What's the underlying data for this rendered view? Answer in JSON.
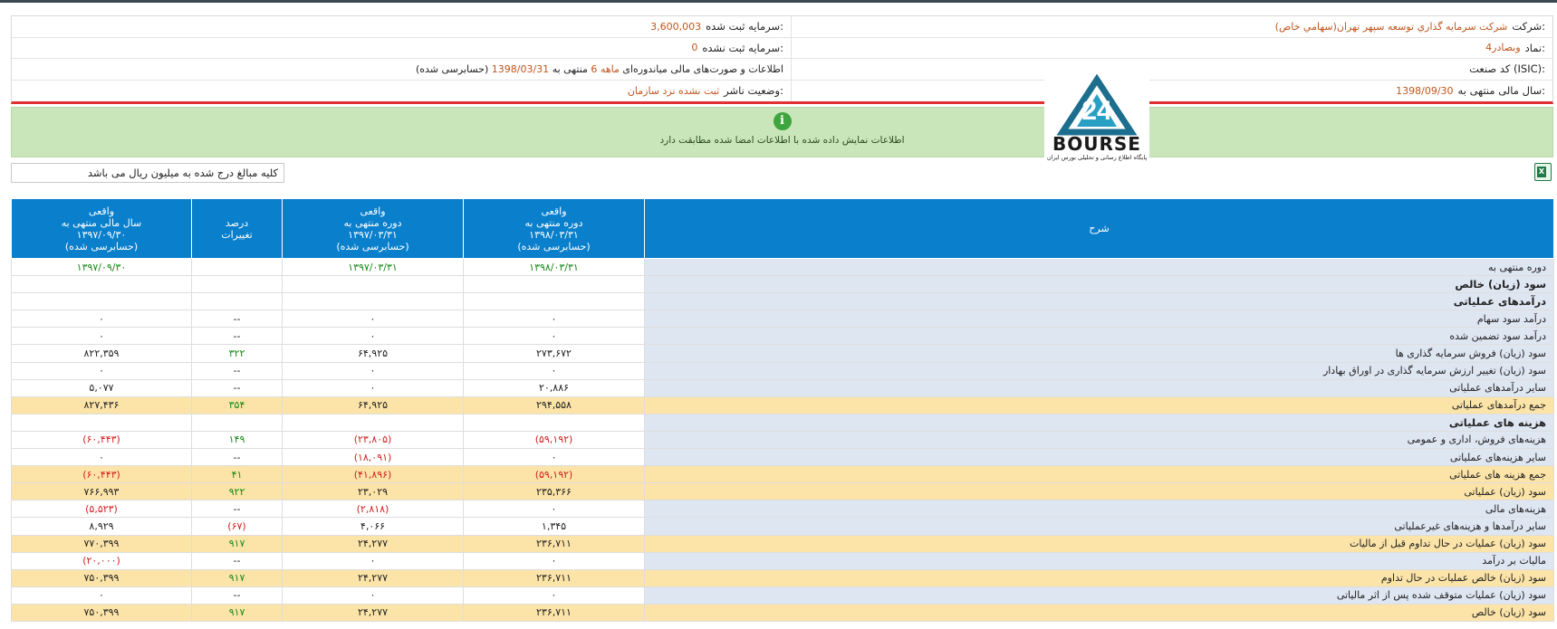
{
  "company_info": {
    "company_label": "شرکت:",
    "company_value": "شرکت سرمايه گذاري توسعه سپهر تهران(سهامي خاص)",
    "registered_capital_label": "سرمایه ثبت شده:",
    "registered_capital_value": "3,600,003",
    "symbol_label": "نماد:",
    "symbol_value": "وبصادر4",
    "unregistered_capital_label": "سرمایه ثبت نشده:",
    "unregistered_capital_value": "0",
    "isic_label": "کد صنعت (ISIC):",
    "isic_value": "",
    "report_text_1": "اطلاعات و صورت‌های مالی میاندوره‌ای",
    "report_period": "6 ماهه",
    "report_text_2": "منتهی به",
    "report_date": "1398/03/31",
    "report_status": "(حسابرسی شده)",
    "fiscal_year_label": "سال مالی منتهی به:",
    "fiscal_year_value": "1398/09/30",
    "publisher_status_label": "وضعیت ناشر:",
    "publisher_status_value": "ثبت نشده نزد سازمان"
  },
  "notice": {
    "icon": "info-icon",
    "message": "اطلاعات نمایش داده شده با اطلاعات امضا شده مطابقت دارد"
  },
  "logo": {
    "word": "BOURSE",
    "mark": "24",
    "subtitle": "پایگاه اطلاع رسانی و تحلیلی بورس ایران"
  },
  "units_note": "کلیه مبالغ درج شده به میلیون ریال می باشد",
  "colors": {
    "header_blue": "#0a7fcb",
    "highlight_row": "#fce4a8",
    "description_bg": "#dee6f2",
    "notice_green": "#c8e6b9",
    "value_orange": "#c0561c",
    "positive_green": "#168a16",
    "negative_red": "#d32020"
  },
  "table": {
    "headers": {
      "description": "شرح",
      "col1": [
        "واقعی",
        "دوره منتهی به",
        "۱۳۹۸/۰۳/۳۱",
        "(حسابرسی شده)"
      ],
      "col2": [
        "واقعی",
        "دوره منتهی به",
        "۱۳۹۷/۰۳/۳۱",
        "(حسابرسی شده)"
      ],
      "col3": [
        "درصد",
        "تغییرات"
      ],
      "col4": [
        "واقعی",
        "سال مالی منتهی به",
        "۱۳۹۷/۰۹/۳۰",
        "(حسابرسی شده)"
      ]
    },
    "rows": [
      {
        "desc": "دوره منتهی به",
        "c1": "۱۳۹۸/۰۳/۳۱",
        "c2": "۱۳۹۷/۰۳/۳۱",
        "c3": "",
        "c4": "۱۳۹۷/۰۹/۳۰",
        "style": "g",
        "row": ""
      },
      {
        "desc": "سود (زیان) خالص",
        "c1": "",
        "c2": "",
        "c3": "",
        "c4": "",
        "style": "k",
        "row": "bold"
      },
      {
        "desc": "درآمدهای عملیاتی",
        "c1": "",
        "c2": "",
        "c3": "",
        "c4": "",
        "style": "k",
        "row": "bold"
      },
      {
        "desc": "درآمد سود سهام",
        "c1": "۰",
        "c2": "۰",
        "c3": "--",
        "c4": "۰",
        "style": "k",
        "row": ""
      },
      {
        "desc": "درآمد سود تضمین شده",
        "c1": "۰",
        "c2": "۰",
        "c3": "--",
        "c4": "۰",
        "style": "k",
        "row": ""
      },
      {
        "desc": "سود (زیان) فروش سرمایه گذاری ها",
        "c1": "۲۷۳,۶۷۲",
        "c2": "۶۴,۹۲۵",
        "c3": "۳۲۲",
        "c4": "۸۲۲,۳۵۹",
        "style": "k",
        "row": ""
      },
      {
        "desc": "سود (زیان) تغییر ارزش سرمایه گذاری در اوراق بهادار",
        "c1": "۰",
        "c2": "۰",
        "c3": "--",
        "c4": "۰",
        "style": "k",
        "row": ""
      },
      {
        "desc": "سایر درآمدهای عملیاتی",
        "c1": "۲۰,۸۸۶",
        "c2": "۰",
        "c3": "--",
        "c4": "۵,۰۷۷",
        "style": "k",
        "row": ""
      },
      {
        "desc": "جمع درآمدهای عملیاتی",
        "c1": "۲۹۴,۵۵۸",
        "c2": "۶۴,۹۲۵",
        "c3": "۳۵۴",
        "c4": "۸۲۷,۴۳۶",
        "style": "k",
        "row": "hl"
      },
      {
        "desc": "هزینه های عملیاتی",
        "c1": "",
        "c2": "",
        "c3": "",
        "c4": "",
        "style": "k",
        "row": "bold"
      },
      {
        "desc": "هزینه‌های فروش، اداری و عمومی",
        "c1": "(۵۹,۱۹۲)",
        "c2": "(۲۳,۸۰۵)",
        "c3": "۱۴۹",
        "c4": "(۶۰,۴۴۳)",
        "style": "neg",
        "row": ""
      },
      {
        "desc": "سایر هزینه‌های عملیاتی",
        "c1": "۰",
        "c2": "(۱۸,۰۹۱)",
        "c3": "--",
        "c4": "۰",
        "style": "neg",
        "row": ""
      },
      {
        "desc": "جمع هزینه های عملیاتی",
        "c1": "(۵۹,۱۹۲)",
        "c2": "(۴۱,۸۹۶)",
        "c3": "۴۱",
        "c4": "(۶۰,۴۴۳)",
        "style": "neg",
        "row": "hl"
      },
      {
        "desc": "سود (زیان) عملیاتی",
        "c1": "۲۳۵,۳۶۶",
        "c2": "۲۳,۰۲۹",
        "c3": "۹۲۲",
        "c4": "۷۶۶,۹۹۳",
        "style": "k",
        "row": "hl"
      },
      {
        "desc": "هزینه‌های مالی",
        "c1": "۰",
        "c2": "(۲,۸۱۸)",
        "c3": "--",
        "c4": "(۵,۵۲۳)",
        "style": "neg",
        "row": ""
      },
      {
        "desc": "سایر درآمدها و هزینه‌های غیرعملیاتی",
        "c1": "۱,۳۴۵",
        "c2": "۴,۰۶۶",
        "c3": "(۶۷)",
        "c4": "۸,۹۲۹",
        "style": "k",
        "row": ""
      },
      {
        "desc": "سود (زیان) عملیات در حال تداوم قبل از مالیات",
        "c1": "۲۳۶,۷۱۱",
        "c2": "۲۴,۲۷۷",
        "c3": "۹۱۷",
        "c4": "۷۷۰,۳۹۹",
        "style": "k",
        "row": "hl"
      },
      {
        "desc": "مالیات بر درآمد",
        "c1": "۰",
        "c2": "۰",
        "c3": "--",
        "c4": "(۲۰,۰۰۰)",
        "style": "neg",
        "row": ""
      },
      {
        "desc": "سود (زیان) خالص عملیات در حال تداوم",
        "c1": "۲۳۶,۷۱۱",
        "c2": "۲۴,۲۷۷",
        "c3": "۹۱۷",
        "c4": "۷۵۰,۳۹۹",
        "style": "k",
        "row": "hl"
      },
      {
        "desc": "سود (زیان) عملیات متوقف شده پس از اثر مالیاتی",
        "c1": "۰",
        "c2": "۰",
        "c3": "--",
        "c4": "۰",
        "style": "k",
        "row": ""
      },
      {
        "desc": "سود (زیان) خالص",
        "c1": "۲۳۶,۷۱۱",
        "c2": "۲۴,۲۷۷",
        "c3": "۹۱۷",
        "c4": "۷۵۰,۳۹۹",
        "style": "k",
        "row": "hl"
      }
    ]
  }
}
